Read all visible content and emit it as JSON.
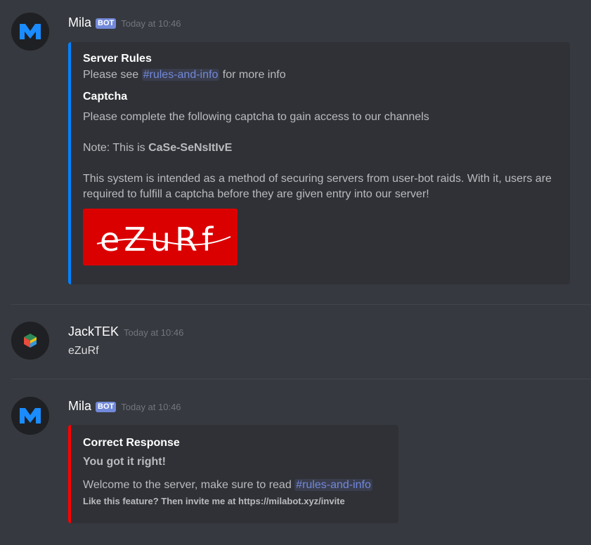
{
  "messages": [
    {
      "author": "Mila",
      "bot_tag": "BOT",
      "timestamp": "Today at 10:46",
      "embed": {
        "rules_title": "Server Rules",
        "rules_before": "Please see ",
        "rules_channel": "#rules-and-info",
        "rules_after": " for more info",
        "captcha_title": "Captcha",
        "captcha_line1": "Please complete the following captcha to gain access to our channels",
        "note_prefix": "Note: This is ",
        "note_strong": "CaSe-SeNsItIvE",
        "description": "This system is intended as a method of securing servers from user-bot raids. With it, users are required to fulfill a captcha before they are given entry into our server!",
        "captcha_text": "eZuRf",
        "accent_color": "#0083ff"
      }
    },
    {
      "author": "JackTEK",
      "timestamp": "Today at 10:46",
      "content": "eZuRf"
    },
    {
      "author": "Mila",
      "bot_tag": "BOT",
      "timestamp": "Today at 10:46",
      "embed": {
        "title": "Correct Response",
        "subtitle": "You got it right!",
        "text_before": "Welcome to the server, make sure to read ",
        "channel": "#rules-and-info",
        "footer": "Like this feature? Then invite me at https://milabot.xyz/invite",
        "accent_color": "#ff0000"
      }
    }
  ],
  "colors": {
    "background": "#36393f",
    "embed_background": "#2f3136",
    "mention": "#7289da",
    "captcha_background": "#db0000"
  },
  "icons": {
    "mila_avatar": "mila-logo-icon",
    "jacktek_avatar": "cube-icon"
  }
}
